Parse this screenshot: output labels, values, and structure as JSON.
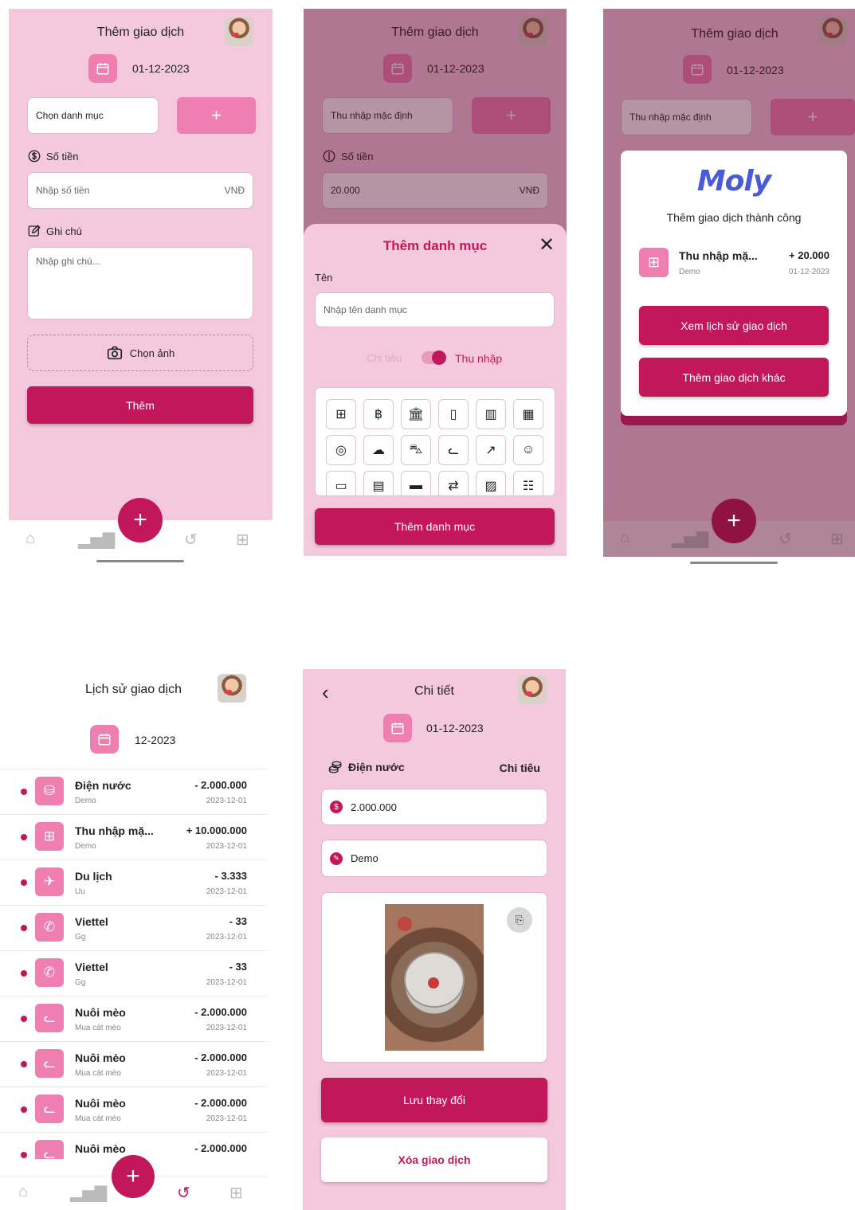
{
  "screen1": {
    "title": "Thêm giao dịch",
    "date": "01-12-2023",
    "category_placeholder": "Chọn danh mục",
    "amount_label": "Số tiền",
    "amount_placeholder": "Nhập số tiền",
    "currency": "VNĐ",
    "note_label": "Ghi chú",
    "note_placeholder": "Nhập ghi chú...",
    "photo_label": "Chọn ảnh",
    "submit_label": "Thêm"
  },
  "screen2": {
    "title": "Thêm giao dịch",
    "date": "01-12-2023",
    "category_value": "Thu nhập mặc định",
    "amount_label": "Số tiền",
    "amount_value": "20.000",
    "currency": "VNĐ",
    "sheet_title": "Thêm danh mục",
    "name_label": "Tên",
    "name_placeholder": "Nhập tên danh mục",
    "toggle_off_label": "Chi tiêu",
    "toggle_on_label": "Thu nhập",
    "submit_label": "Thêm danh mục"
  },
  "screen3": {
    "title": "Thêm giao dịch",
    "date": "01-12-2023",
    "category_value": "Thu nhập mặc định",
    "logo_text": "Moly",
    "success_message": "Thêm giao dịch thành công",
    "tx_name": "Thu nhập mặ...",
    "tx_note": "Demo",
    "tx_amount": "+ 20.000",
    "tx_date": "01-12-2023",
    "history_button": "Xem lịch sử giao dịch",
    "add_other_button": "Thêm giao dịch khác"
  },
  "screen4": {
    "title": "Lịch sử giao dịch",
    "month": "12-2023",
    "transactions": [
      {
        "name": "Điện nước",
        "note": "Demo",
        "amount": "- 2.000.000",
        "date": "2023-12-01",
        "icon": "coins-icon"
      },
      {
        "name": "Thu nhập mặ...",
        "note": "Demo",
        "amount": "+ 10.000.000",
        "date": "2023-12-01",
        "icon": "grid-plus-icon"
      },
      {
        "name": "Du lịch",
        "note": "Uu",
        "amount": "- 3.333",
        "date": "2023-12-01",
        "icon": "plane-icon"
      },
      {
        "name": "Viettel",
        "note": "Gg",
        "amount": "- 33",
        "date": "2023-12-01",
        "icon": "phone-icon"
      },
      {
        "name": "Viettel",
        "note": "Gg",
        "amount": "- 33",
        "date": "2023-12-01",
        "icon": "phone-icon"
      },
      {
        "name": "Nuôi mèo",
        "note": "Mua cát mèo",
        "amount": "- 2.000.000",
        "date": "2023-12-01",
        "icon": "cat-icon"
      },
      {
        "name": "Nuôi mèo",
        "note": "Mua cát mèo",
        "amount": "- 2.000.000",
        "date": "2023-12-01",
        "icon": "cat-icon"
      },
      {
        "name": "Nuôi mèo",
        "note": "Mua cát mèo",
        "amount": "- 2.000.000",
        "date": "2023-12-01",
        "icon": "cat-icon"
      },
      {
        "name": "Nuôi mèo",
        "note": "",
        "amount": "- 2.000.000",
        "date": "",
        "icon": "cat-icon"
      }
    ]
  },
  "screen5": {
    "title": "Chi tiết",
    "date": "01-12-2023",
    "category": "Điện nước",
    "type": "Chi tiêu",
    "amount": "2.000.000",
    "note": "Demo",
    "save_button": "Lưu thay đổi",
    "delete_button": "Xóa giao dịch"
  },
  "colors": {
    "accent": "#c2185b",
    "pink_light": "#f4c9de",
    "pink_mid": "#ee7fb0"
  }
}
